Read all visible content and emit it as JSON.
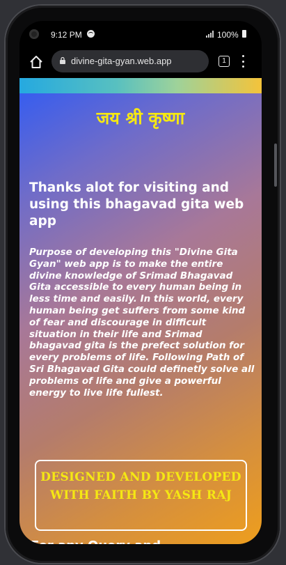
{
  "status_bar": {
    "time": "9:12 PM",
    "battery": "100%"
  },
  "browser": {
    "url": "divine-gita-gyan.web.app",
    "tab_count": "1"
  },
  "page": {
    "title": "जय श्री कृष्णा",
    "thanks": "Thanks alot for visiting and using this bhagavad gita web app",
    "purpose": "Purpose of developing this \"Divine Gita Gyan\" web app is to make the entire divine knowledge of Srimad Bhagavad Gita accessible to every human being in less time and easily. In this world, every human being get suffers from some kind of fear and discourage in difficult situation in their life and Srimad bhagavad gita is the prefect solution for every problems of life. Following Path of Sri Bhagavad Gita could definetly solve all problems of life and give a powerful energy to live life fullest.",
    "credit": "DESIGNED AND DEVELOPED WITH FAITH BY YASH RAJ",
    "query": "For any Query and feedback, Find"
  },
  "icons": {
    "social": [
      "linkedin-icon",
      "github-icon",
      "facebook-icon"
    ]
  },
  "colors": {
    "title": "#f5e813",
    "gradient_start": "#2f5bf4",
    "gradient_end": "#ee9e1d"
  }
}
